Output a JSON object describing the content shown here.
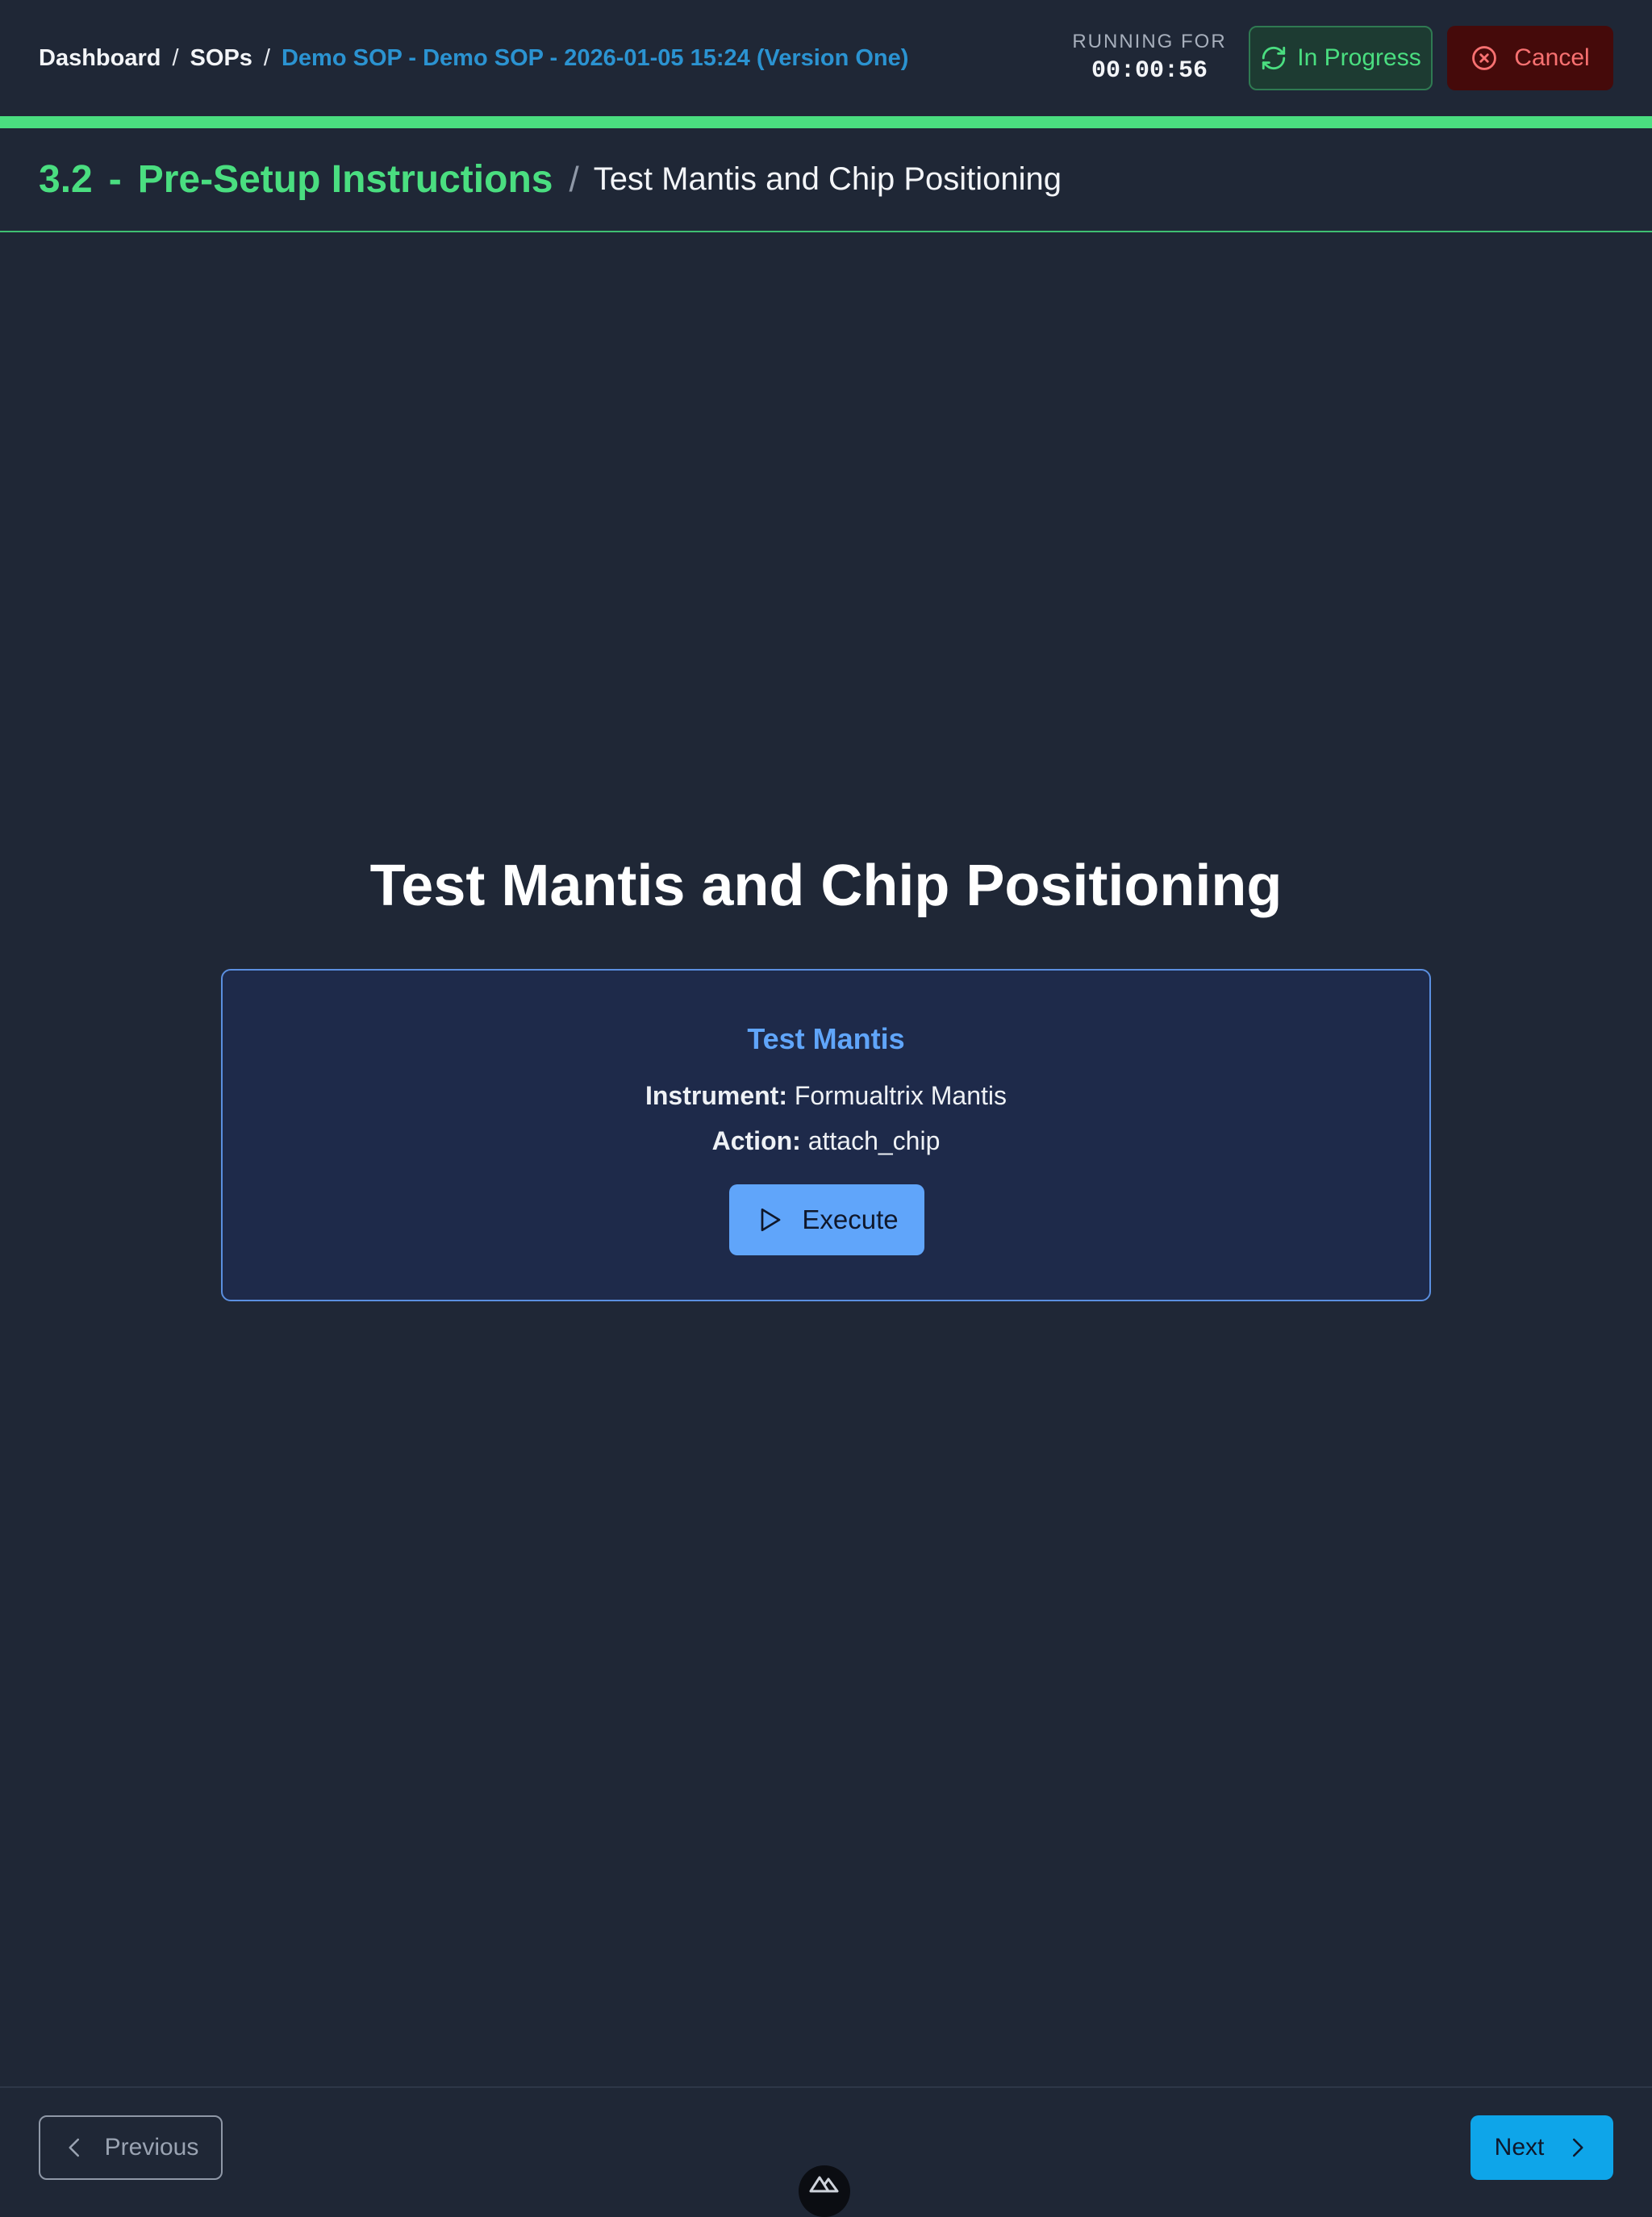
{
  "header": {
    "breadcrumb": {
      "items": [
        "Dashboard",
        "SOPs"
      ],
      "separator": "/",
      "current": "Demo SOP - Demo SOP - 2026-01-05 15:24 (Version One)"
    },
    "timer": {
      "label": "RUNNING FOR",
      "value": "00:00:56"
    },
    "status": {
      "label": "In Progress",
      "icon": "refresh-icon"
    },
    "cancel": {
      "label": "Cancel",
      "icon": "x-circle-icon"
    },
    "progress": {
      "value_fraction": 1.0
    }
  },
  "section": {
    "number": "3.2",
    "dash": "-",
    "title": "Pre-Setup Instructions",
    "separator": "/",
    "step_title": "Test Mantis and Chip Positioning"
  },
  "main": {
    "title": "Test Mantis and Chip Positioning",
    "card": {
      "title": "Test Mantis",
      "instrument_label": "Instrument:",
      "instrument_value": "Formualtrix Mantis",
      "action_label": "Action:",
      "action_value": "attach_chip",
      "execute_label": "Execute",
      "execute_icon": "play-icon"
    }
  },
  "footer": {
    "previous_label": "Previous",
    "next_label": "Next",
    "devtools_icon": "nuxt-logo-icon"
  },
  "colors": {
    "background": "#1f2736",
    "accent_green": "#4ade80",
    "link_blue": "#2b93d1",
    "card_blue": "#60a5fa",
    "danger": "#f87171",
    "next_button": "#0ea5e9"
  }
}
